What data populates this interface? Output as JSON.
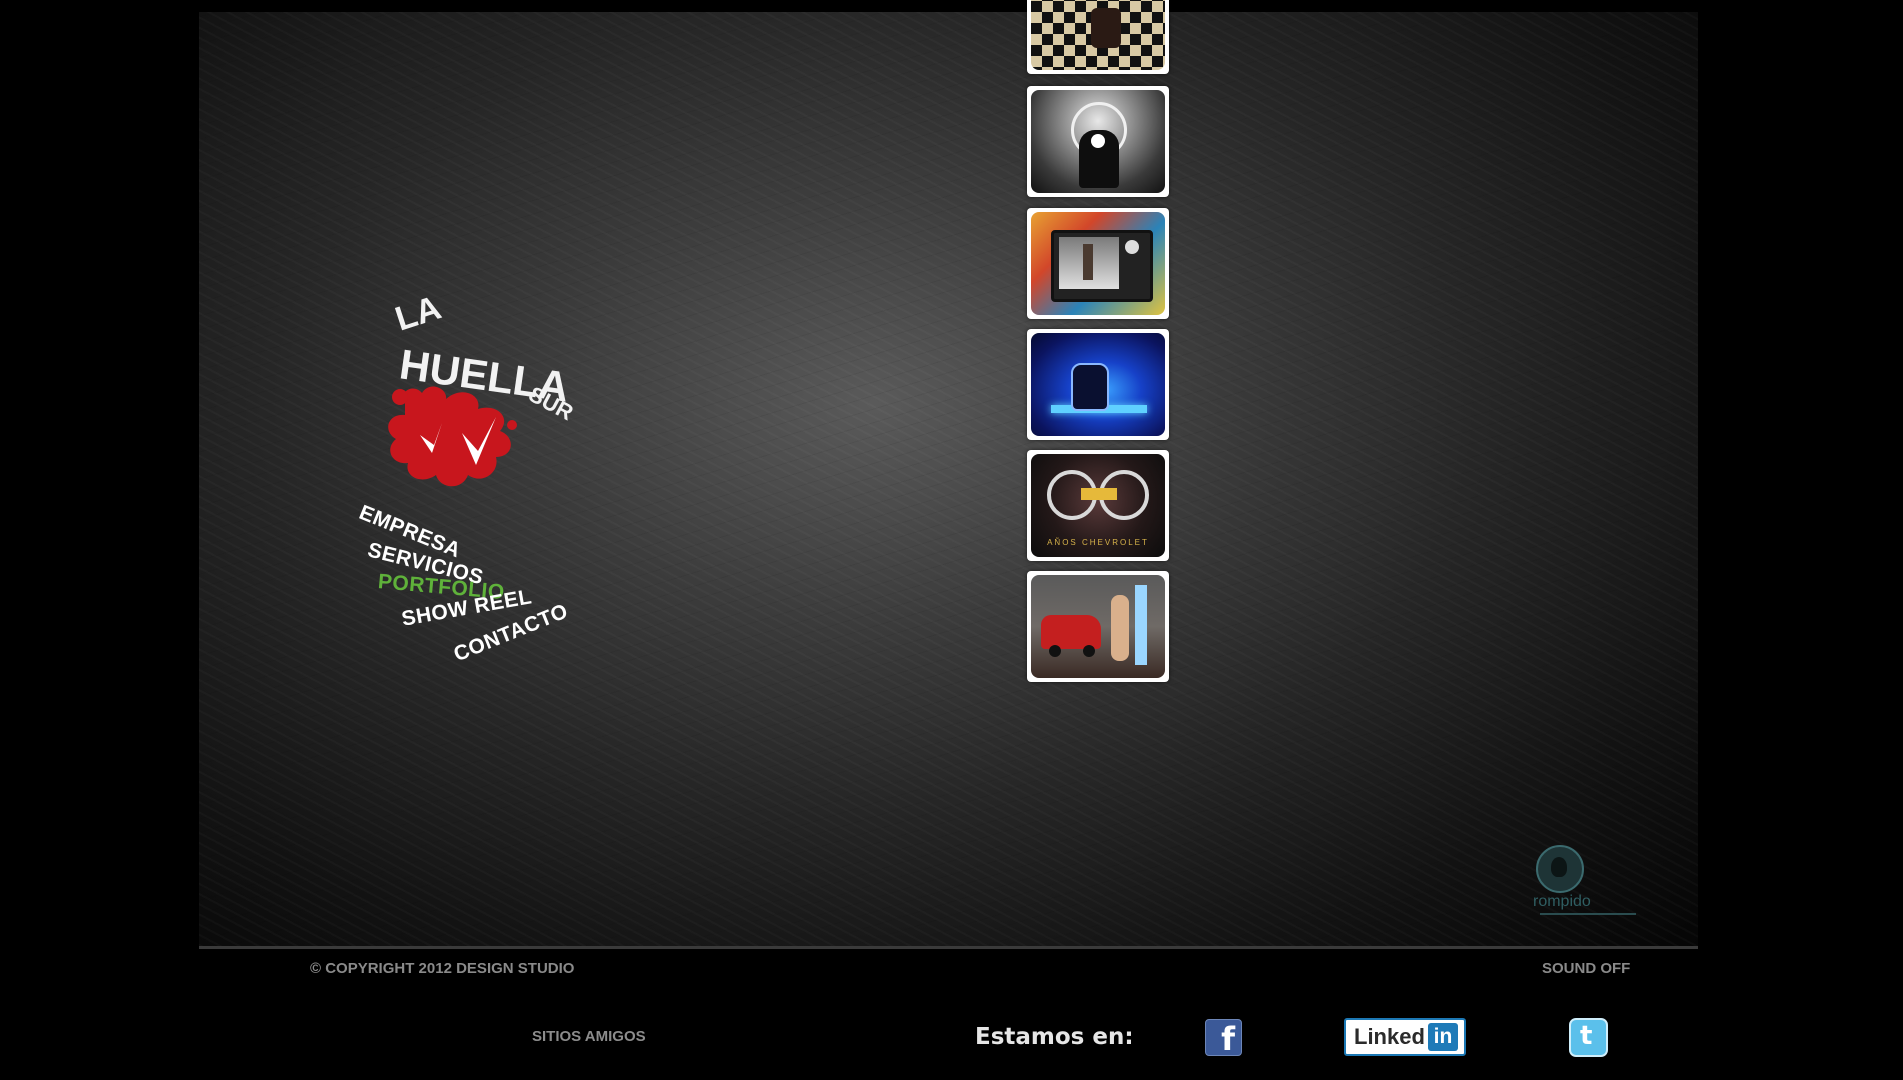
{
  "logo": {
    "line1": "LA",
    "line2": "HUELLA",
    "line3": "SUR"
  },
  "nav": {
    "items": [
      {
        "label": "EMPRESA"
      },
      {
        "label": "SERVICIOS"
      },
      {
        "label": "PORTFOLIO"
      },
      {
        "label": "SHOW REEL"
      },
      {
        "label": "CONTACTO"
      }
    ],
    "active_color": "#5fb23a"
  },
  "portfolio": {
    "thumb_5_caption": "AÑOS CHEVROLET"
  },
  "credit": {
    "name": "rompido"
  },
  "footer": {
    "copyright": "© COPYRIGHT 2012 DESIGN STUDIO",
    "sound": "SOUND OFF",
    "sitios": "SITIOS AMIGOS",
    "estamos": "Estamos en:",
    "facebook_glyph": "f",
    "linkedin_text": "Linked",
    "linkedin_in": "in",
    "twitter_glyph": "t"
  },
  "colors": {
    "brand_red": "#c8161d",
    "accent_green": "#5fb23a"
  }
}
